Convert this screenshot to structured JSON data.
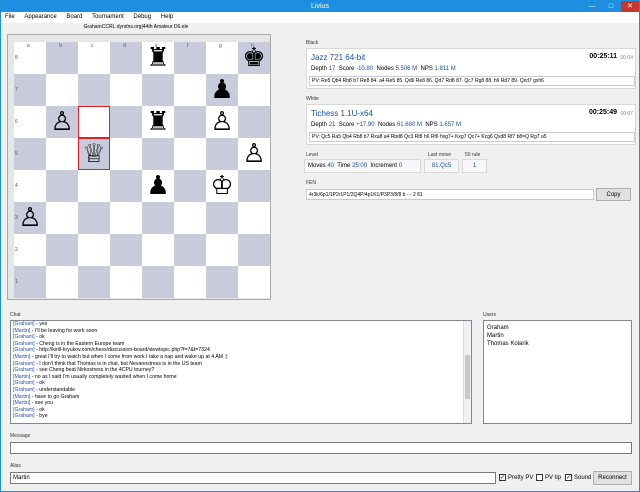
{
  "window": {
    "title": "Livius",
    "minimize": "—",
    "maximize": "□",
    "close": "✕"
  },
  "menu": [
    "File",
    "Appearance",
    "Board",
    "Tournament",
    "Debug",
    "Help"
  ],
  "board": {
    "title": "GrahamCCRL.dyndns.org|44th Amateur D6.ele",
    "files": [
      "a",
      "b",
      "c",
      "d",
      "e",
      "f",
      "g",
      "h"
    ],
    "ranks": [
      "8",
      "7",
      "6",
      "5",
      "4",
      "3",
      "2",
      "1"
    ],
    "pieces": [
      {
        "sq": "e8",
        "glyph": "♜",
        "name": "black-rook"
      },
      {
        "sq": "h8",
        "glyph": "♚",
        "name": "black-king"
      },
      {
        "sq": "g7",
        "glyph": "♟",
        "name": "black-pawn"
      },
      {
        "sq": "b6",
        "glyph": "♙",
        "name": "white-pawn"
      },
      {
        "sq": "e6",
        "glyph": "♜",
        "name": "black-rook"
      },
      {
        "sq": "g6",
        "glyph": "♙",
        "name": "white-pawn"
      },
      {
        "sq": "c5",
        "glyph": "♕",
        "name": "white-queen"
      },
      {
        "sq": "h5",
        "glyph": "♙",
        "name": "white-pawn"
      },
      {
        "sq": "e4",
        "glyph": "♟",
        "name": "black-pawn"
      },
      {
        "sq": "g4",
        "glyph": "♔",
        "name": "white-king"
      },
      {
        "sq": "a3",
        "glyph": "♙",
        "name": "white-pawn"
      }
    ],
    "highlight": [
      "c6",
      "c5"
    ]
  },
  "black": {
    "label": "Black",
    "engine": "Jazz 721 64-bit",
    "time": "00:25:11",
    "time_small": "00:04",
    "depth_label": "Depth",
    "depth": "17",
    "score_label": "Score",
    "score": "-10.80",
    "nodes_label": "Nodes",
    "nodes": "5.506 M",
    "nps_label": "NPS",
    "nps": "1.811 M",
    "pv": "PV:  Re5 Qb4 Rb8 b7 Re8  84. a4    Re5  85. Qd6  Re8  86. Qd7  Rd8  87. Qc7  Rg8  88. h6  Rd7  89. Qxd7  gxh6"
  },
  "white": {
    "label": "White",
    "engine": "Tichess 1.1U-x64",
    "time": "00:25:49",
    "time_small": "00:07",
    "depth_label": "Depth",
    "depth": "21",
    "score_label": "Score",
    "score": "+17.90",
    "nodes_label": "Nodes",
    "nodes": "61.680 M",
    "nps_label": "NPS",
    "nps": "1.657 M",
    "pv": "PV:  Qc5 Ra5 Qb4 Rb8 b7 Rxa8 a4 Rbd8 Qc3 Rf8 h6 Rf6 hxg7+ Kxg7 Qc7+ Kcg6 Qxd8 Rf7 b8=Q Rg7 a5"
  },
  "level": {
    "label": "Level",
    "moves_label": "Moves",
    "moves": "40",
    "time_label": "Time",
    "time": "25:00",
    "inc_label": "Increment",
    "inc": "0"
  },
  "lastmove": {
    "label": "Last move",
    "value": "81.Qc5"
  },
  "rule50": {
    "label": "50 rule",
    "value": "1"
  },
  "fen": {
    "label": "FEN",
    "value": "4r3k/6p1/1P2r1P1/2Q4P/4p1K1/P3P3/8/8 b - - 2 81",
    "copy": "Copy"
  },
  "chat": {
    "label": "Chat",
    "lines": [
      {
        "nick": "[Graham]",
        "text": " - yes"
      },
      {
        "nick": "[Martin]",
        "text": " - I'll be leaving for work soon"
      },
      {
        "nick": "[Graham]",
        "text": " - ok"
      },
      {
        "nick": "[Graham]",
        "text": " - Cheng is in the Eastern Europe team"
      },
      {
        "nick": "[Graham]",
        "text": " - http://kirill-kryukov.com/chess/discussion-board/viewtopic.php?f=7&t=7324"
      },
      {
        "nick": "[Martin]",
        "text": " - great I'll try to watch but when I come from work I take a nap and wake up at 4 AM :)"
      },
      {
        "nick": "[Graham]",
        "text": " - I don't think that Thomas is in chat, but Nevanostress is in the US team"
      },
      {
        "nick": "[Graham]",
        "text": " - see Cheng beat Nirkostress in the 4CPU tourney?"
      },
      {
        "nick": "[Martin]",
        "text": " - no as I said I'm usually completely wasted when I come home"
      },
      {
        "nick": "[Graham]",
        "text": " - ok"
      },
      {
        "nick": "[Graham]",
        "text": " - understandable"
      },
      {
        "nick": "[Martin]",
        "text": " - have to go Graham"
      },
      {
        "nick": "[Martin]",
        "text": " - see you"
      },
      {
        "nick": "[Graham]",
        "text": " - ok"
      },
      {
        "nick": "[Graham]",
        "text": " - bye"
      }
    ]
  },
  "users": {
    "label": "Users",
    "list": [
      "Graham",
      "Martin",
      "Thomas Kolarik"
    ]
  },
  "message": {
    "label": "Message",
    "value": ""
  },
  "alias": {
    "label": "Alias",
    "value": "Martin"
  },
  "options": {
    "pretty_pv": "Pretty PV",
    "pv_tip": "PV tip",
    "sound": "Sound",
    "reconnect": "Reconnect"
  },
  "colors": {
    "accent": "#1e8ee0",
    "light_square": "#ffffff",
    "dark_square": "#c8cbdc",
    "highlight": "#e02020",
    "link_blue": "#1a4fa8"
  }
}
